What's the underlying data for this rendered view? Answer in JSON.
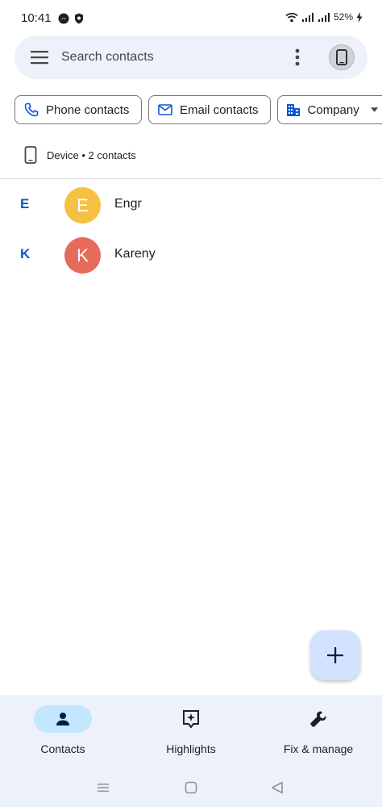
{
  "status_bar": {
    "time": "10:41",
    "battery": "52%"
  },
  "search": {
    "placeholder": "Search contacts"
  },
  "chips": [
    {
      "label": "Phone contacts",
      "icon": "phone-icon"
    },
    {
      "label": "Email contacts",
      "icon": "mail-icon"
    },
    {
      "label": "Company",
      "icon": "building-icon"
    }
  ],
  "device": {
    "label": "Device • 2 contacts",
    "icon": "device-phone-icon"
  },
  "contacts": [
    {
      "section": "E",
      "initial": "E",
      "name": "Engr",
      "color": "#f6c143"
    },
    {
      "section": "K",
      "initial": "K",
      "name": "Kareny",
      "color": "#e66b5b"
    }
  ],
  "bottom_nav": {
    "items": [
      {
        "label": "Contacts",
        "icon": "person-icon",
        "active": true
      },
      {
        "label": "Highlights",
        "icon": "sparkle-icon",
        "active": false
      },
      {
        "label": "Fix & manage",
        "icon": "wrench-icon",
        "active": false
      }
    ]
  },
  "colors": {
    "accent": "#0b57d0",
    "surface": "#edf2fa",
    "active_pill": "#c2e7ff",
    "fab": "#d3e3fd"
  }
}
